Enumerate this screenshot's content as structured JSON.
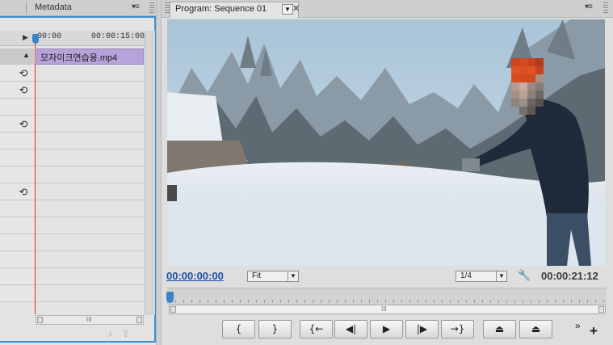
{
  "left_panel": {
    "tab_label": "Metadata",
    "ruler": {
      "start_time": "00:00",
      "end_time": "00:00:15:00"
    },
    "clip_label": "모자이크연습용.mp4",
    "rows": [
      {
        "sync": false
      },
      {
        "sync": true
      },
      {
        "sync": true
      },
      {
        "sync": false
      },
      {
        "sync": true
      },
      {
        "sync": false
      },
      {
        "sync": false
      },
      {
        "sync": false
      },
      {
        "sync": true
      },
      {
        "sync": false
      },
      {
        "sync": false
      },
      {
        "sync": false
      },
      {
        "sync": false
      },
      {
        "sync": false
      },
      {
        "sync": false
      },
      {
        "sync": false
      },
      {
        "sync": false
      }
    ],
    "sync_icon": "sync-lock-icon"
  },
  "program_monitor": {
    "tab_label": "Program: Sequence 01",
    "current_timecode": "00:00:00:00",
    "fit_option": "Fit",
    "resolution_option": "1/4",
    "duration_timecode": "00:00:21:12",
    "zoom_grip_label": "III",
    "transport_buttons": [
      {
        "name": "mark-in-button",
        "glyph": "{"
      },
      {
        "name": "mark-out-button",
        "glyph": "}"
      },
      {
        "name": "go-to-in-button",
        "glyph": "{←"
      },
      {
        "name": "step-back-button",
        "glyph": "◀|"
      },
      {
        "name": "play-button",
        "glyph": "▶"
      },
      {
        "name": "step-forward-button",
        "glyph": "|▶"
      },
      {
        "name": "go-to-out-button",
        "glyph": "→}"
      },
      {
        "name": "lift-button",
        "glyph": "⏏"
      },
      {
        "name": "extract-button",
        "glyph": "⏏"
      }
    ],
    "more_glyph": "»",
    "add_glyph": "+"
  },
  "colors": {
    "panel_focus": "#3a8fd0",
    "playhead": "#d73a3a",
    "clip": "#b7a2d9",
    "timecode_blue": "#1a4fa5"
  }
}
